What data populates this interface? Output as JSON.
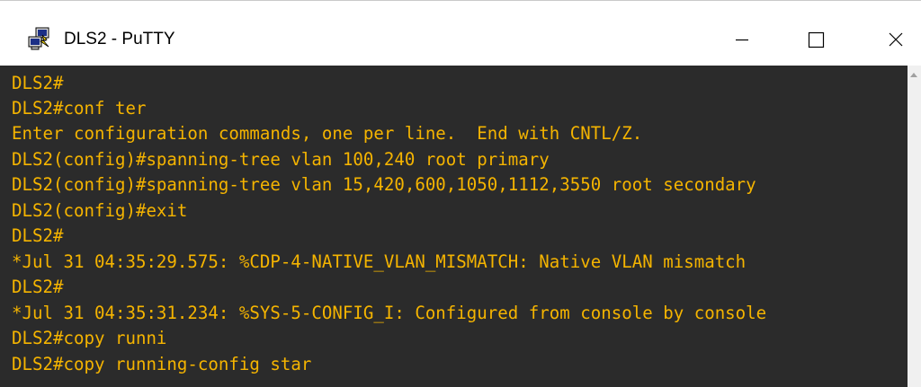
{
  "window": {
    "title": "DLS2 - PuTTY",
    "icon": "putty-icon"
  },
  "title_buttons": {
    "minimize_icon": "minimize-icon",
    "maximize_icon": "maximize-icon",
    "close_icon": "close-icon"
  },
  "terminal": {
    "text_color": "#f5b400",
    "background": "#2b2b2b",
    "lines": [
      "DLS2#",
      "DLS2#conf ter",
      "Enter configuration commands, one per line.  End with CNTL/Z.",
      "DLS2(config)#spanning-tree vlan 100,240 root primary",
      "DLS2(config)#spanning-tree vlan 15,420,600,1050,1112,3550 root secondary",
      "DLS2(config)#exit",
      "DLS2#",
      "*Jul 31 04:35:29.575: %CDP-4-NATIVE_VLAN_MISMATCH: Native VLAN mismatch",
      "DLS2#",
      "*Jul 31 04:35:31.234: %SYS-5-CONFIG_I: Configured from console by console",
      "DLS2#copy runni",
      "DLS2#copy running-config star"
    ]
  }
}
